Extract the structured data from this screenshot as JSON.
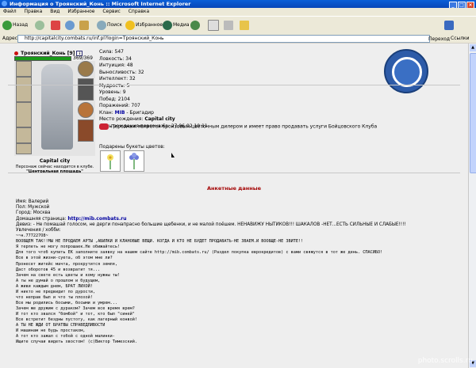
{
  "window": {
    "title": "Информация о Троянский_Конь :: Microsoft Internet Explorer"
  },
  "menu": [
    "Файл",
    "Правка",
    "Вид",
    "Избранное",
    "Сервис",
    "Справка"
  ],
  "toolbar": {
    "back": "Назад",
    "search": "Поиск",
    "favorites": "Избранное",
    "media": "Медиа"
  },
  "address": {
    "label": "Адрес:",
    "url": "http://capitalcity.combats.ru/inf.pl?login=Троянский_Конь",
    "go": "Переход",
    "links": "Ссылки"
  },
  "character": {
    "name": "Троянский_Конь",
    "level": "[9]",
    "hp": "369/369",
    "hp_fraction": 1.0,
    "city": "Capital city",
    "location_line1": "Персонаж сейчас находится в клубе.",
    "location_line2": "\"Центральная площадь\""
  },
  "stats": [
    "Сила: 547",
    "Ловкость: 34",
    "Интуиция: 48",
    "Выносливость: 32",
    "Интеллект: 32",
    "Мудрость: 5"
  ],
  "info": {
    "level": "Уровень: 9",
    "wins": "Побед: 2104",
    "losses": "Поражений: 707",
    "clan_label": "Клан:",
    "clan_name": "MIB",
    "clan_rank": "- Бригадир",
    "birthplace_label": "Место рождения:",
    "birthplace": "Capital city",
    "birthday": "День рождения персонажа: 27.06.02 10:11"
  },
  "bronze_text": "Персонаж является бронзовым цветочным дилером и имеет право продавать услуги Бойцовского Клуба",
  "flowers_label": "Подарены букеты цветов:",
  "anket": {
    "title": "Анкетные данные",
    "name": "Имя: Валерий",
    "sex": "Пол: Мужской",
    "city": "Город: Москва",
    "homepage_label": "Домашняя страница:",
    "homepage": "http://mib.combats.ru",
    "motto": "Девиз: - Не помашай голосом, не дерги понапрасно большие щебенки, и не малой поёшем. НЕНАВИЖУ НЫТИКОВ!!! ШАКАЛОВ -НЕТ...ЕСТЬ СИЛЬНЫЕ И СЛАБЫЕ!!!!",
    "hobbies": "Увлечения / хобби:",
    "lines": [
      "~~н.777227О8~",
      "ВООБЩЕМ ТАК!!МЫ НЕ ПРОДАЕМ АРТЫ ,АБИЛКИ И КЛАНОВЫЕ ВЕЩИ. КОГДА И КТО НЕ БУДЕТ ПРОДАВАТЬ-НЕ ЗВАЕМ.И ВООБЩЕ-НЕ ЗВИТЕ!!",
      "Я терпеть не могу попрошаек.Не обижайтесь!",
      "Для того чтоб купить ЕК заполните заявку на нашем сайте http://mib.combats.ru/ (Раздел покупка еврокредитов) с вами свяжутся в тот же день. СПАСИБО!",
      "Все в этой жизни-суета, об этом мне ли?",
      "Пронесет житейс мачта, прокрутится земля,",
      "Даст оборотов 45 и возвратит тя...",
      "Зачем на свете есть цветы и кому нужны ты!",
      "А ты не думай о прошлом и будущем,",
      "А живи каждым днем, БРАТ ЛИХОЙ!",
      "И никто не предвидит по дурости,",
      "что неправ был и что ты плохой!",
      "Все мы родились босыми, босыми и умрем...",
      "Зачем же дружим с дураком? Зачем все время врем?",
      "И тот кто звался \"бомбой\" и тот, кто был \"синей\"",
      "Все встретит бездны пустоту, как лагерный конвой!",
      "А ТЫ НЕ ЖДИ ОТ БРАТВЫ СПРАВЕДЛИВОСТИ",
      "И машинам не будь простаком,",
      "А тот кто зажал с тобой с одной малинки-",
      "Ищите случаи видеть хвостом! (с)Виктор Тимезский."
    ]
  },
  "watermark": "photo.scrolls.ru",
  "colors": {
    "titlebar": "#0846b8",
    "hp": "#1a9a1a",
    "anket_title": "#a30000",
    "link": "#0000a0"
  }
}
